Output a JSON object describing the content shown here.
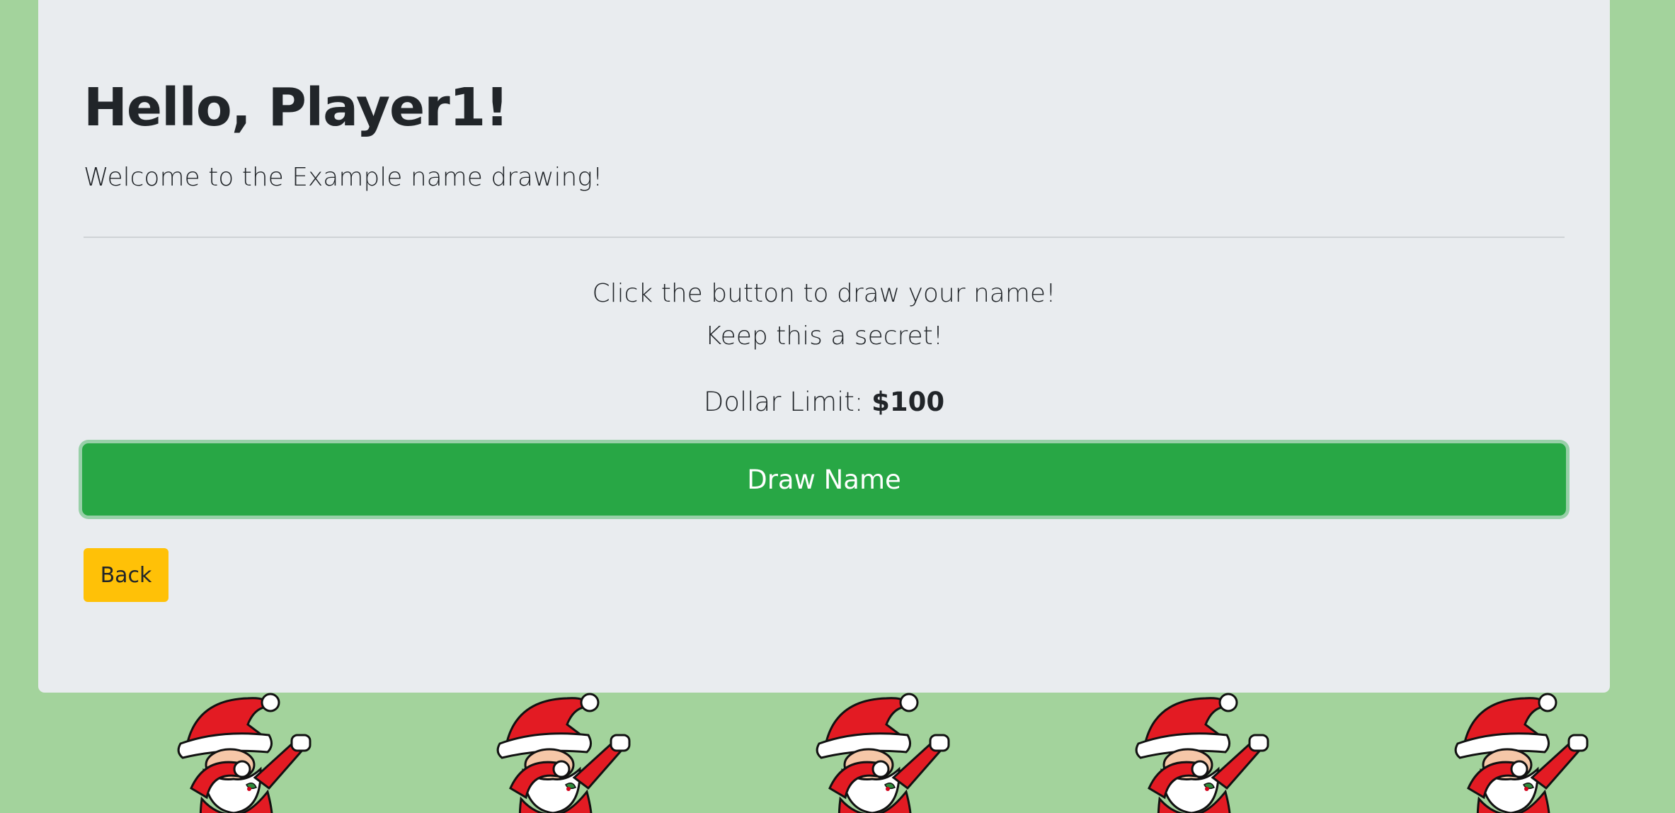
{
  "header": {
    "greeting": "Hello, Player1!",
    "welcome": "Welcome to the Example name drawing!"
  },
  "instructions": {
    "line1": "Click the button to draw your name!",
    "line2": "Keep this a secret!"
  },
  "limit": {
    "label": "Dollar Limit:",
    "value": "$100"
  },
  "buttons": {
    "draw_label": "Draw Name",
    "back_label": "Back"
  },
  "colors": {
    "background": "#a3d39c",
    "panel": "#e9ecef",
    "draw_button": "#28a745",
    "back_button": "#ffc107"
  },
  "background_pattern": {
    "icon": "dabbing-santa-icon"
  }
}
